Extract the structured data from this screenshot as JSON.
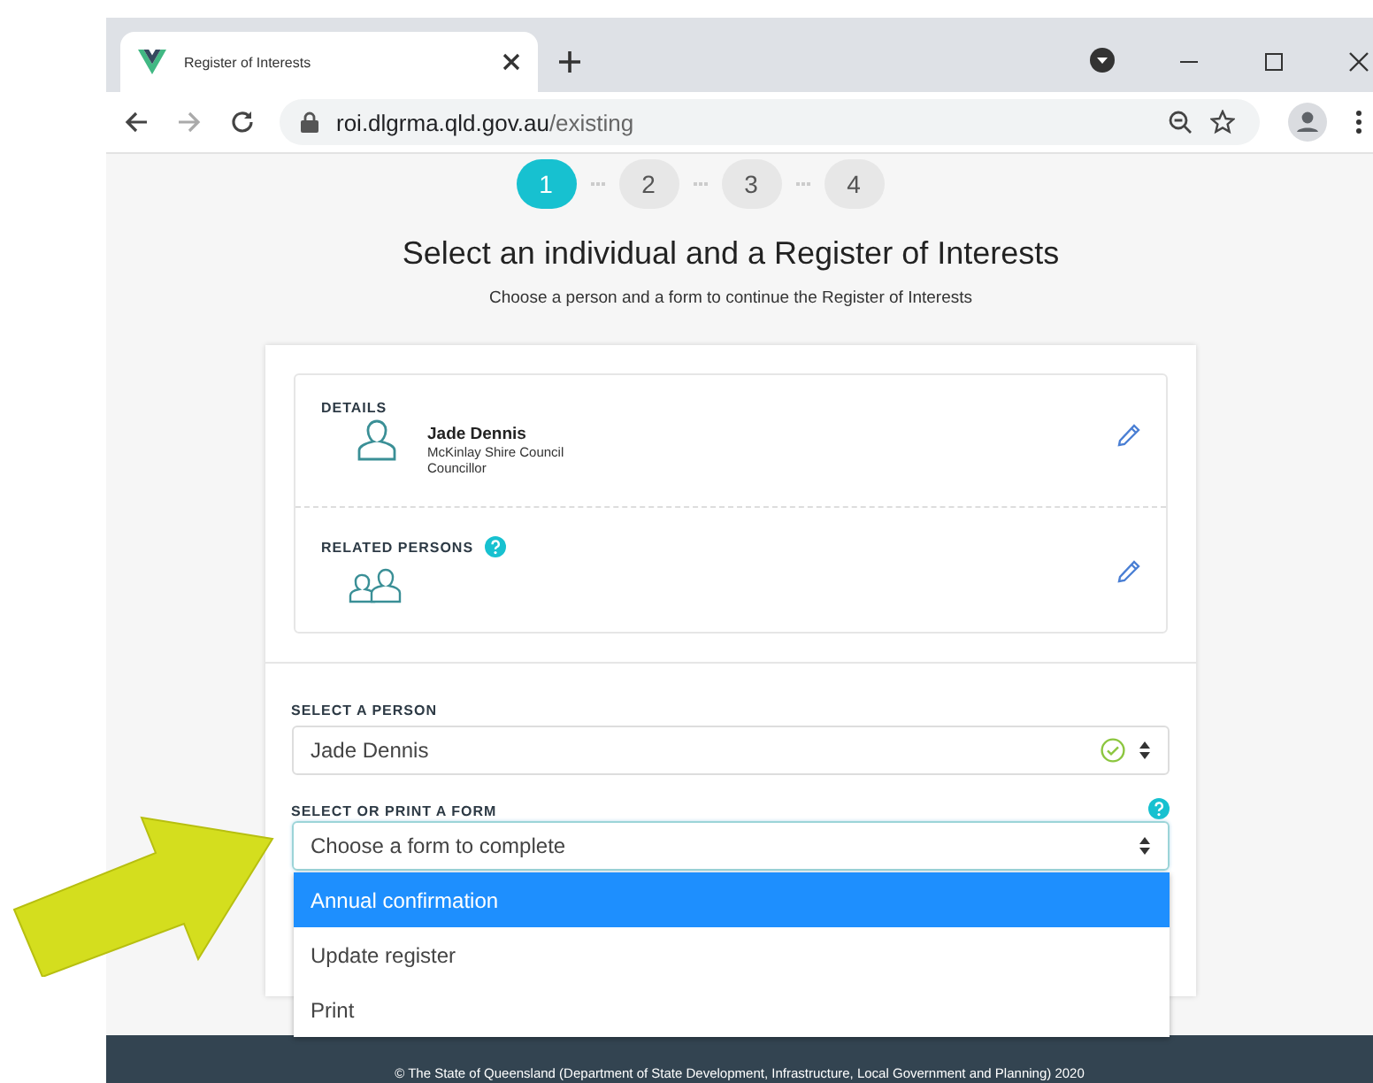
{
  "browser": {
    "tab_title": "Register of Interests",
    "url_host": "roi.dlgrma.qld.gov.au",
    "url_path": "/existing"
  },
  "steps": [
    {
      "label": "1",
      "selected": true
    },
    {
      "label": "2",
      "selected": false
    },
    {
      "label": "3",
      "selected": false
    },
    {
      "label": "4",
      "selected": false
    }
  ],
  "heading": "Select an individual and a Register of Interests",
  "subheading": "Choose a person and a form to continue the Register of Interests",
  "details": {
    "label": "DETAILS",
    "name": "Jade Dennis",
    "council": "McKinlay Shire Council",
    "role": "Councillor"
  },
  "related": {
    "label": "RELATED PERSONS"
  },
  "person_select": {
    "label": "SELECT A PERSON",
    "value": "Jade Dennis",
    "valid": true
  },
  "form_select": {
    "label": "SELECT OR PRINT A FORM",
    "value": "Choose a form to complete",
    "expanded": true,
    "options": [
      {
        "label": "Annual confirmation",
        "selected": true
      },
      {
        "label": "Update register",
        "selected": false
      },
      {
        "label": "Print",
        "selected": false
      }
    ]
  },
  "footer": "© The State of Queensland (Department of State Development, Infrastructure, Local Government and Planning) 2020"
}
